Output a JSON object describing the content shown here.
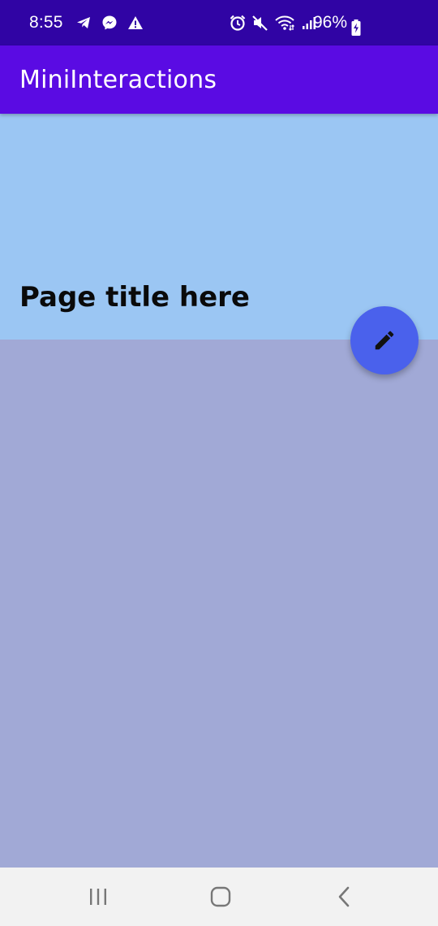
{
  "status_bar": {
    "time": "8:55",
    "battery_percent": "96%",
    "left_icons": [
      "telegram-icon",
      "messenger-icon",
      "warning-icon"
    ],
    "right_icons": [
      "alarm-icon",
      "mute-icon",
      "wifi-icon",
      "signal-icon",
      "battery-charging-icon"
    ]
  },
  "app_bar": {
    "title": "MiniInteractions"
  },
  "header": {
    "page_title": "Page title here"
  },
  "fab": {
    "icon": "edit-icon"
  },
  "nav_bar": {
    "buttons": [
      "recents-icon",
      "home-icon",
      "back-icon"
    ]
  },
  "colors": {
    "status_bar": "#3004a4",
    "app_bar": "#5a0be3",
    "header_bg": "#9bc6f3",
    "body_bg": "#a1a9d6",
    "fab_bg": "#4a61ec",
    "nav_bar_bg": "#f2f2f2"
  }
}
